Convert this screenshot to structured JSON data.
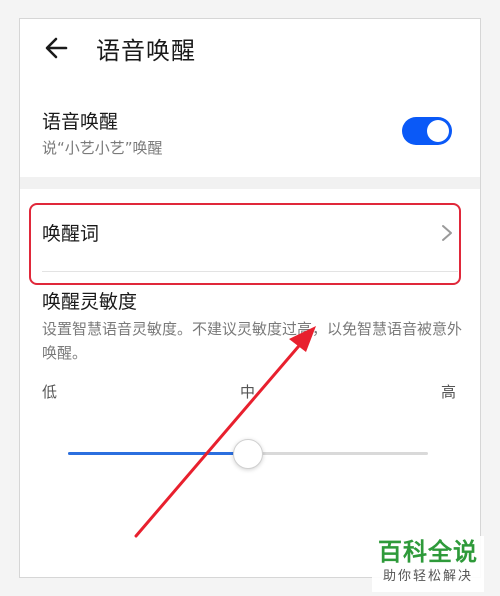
{
  "header": {
    "title": "语音唤醒",
    "back_icon": "arrow-left-icon"
  },
  "voice_wakeup": {
    "title": "语音唤醒",
    "subtitle": "说“小艺小艺”唤醒",
    "toggle_on": true,
    "toggle_color": "#0a59f7"
  },
  "wake_word": {
    "label": "唤醒词",
    "chevron_icon": "chevron-right-icon"
  },
  "sensitivity": {
    "title": "唤醒灵敏度",
    "description": "设置智慧语音灵敏度。不建议灵敏度过高，以免智慧语音被意外唤醒。",
    "low_label": "低",
    "mid_label": "中",
    "high_label": "高",
    "level_fraction": 0.5,
    "accent_color": "#2b6fdf"
  },
  "annotation": {
    "highlight_color": "#e0283a"
  },
  "watermark": {
    "main": "百科全说",
    "sub": "助你轻松解决",
    "color": "#2e9a3a"
  }
}
